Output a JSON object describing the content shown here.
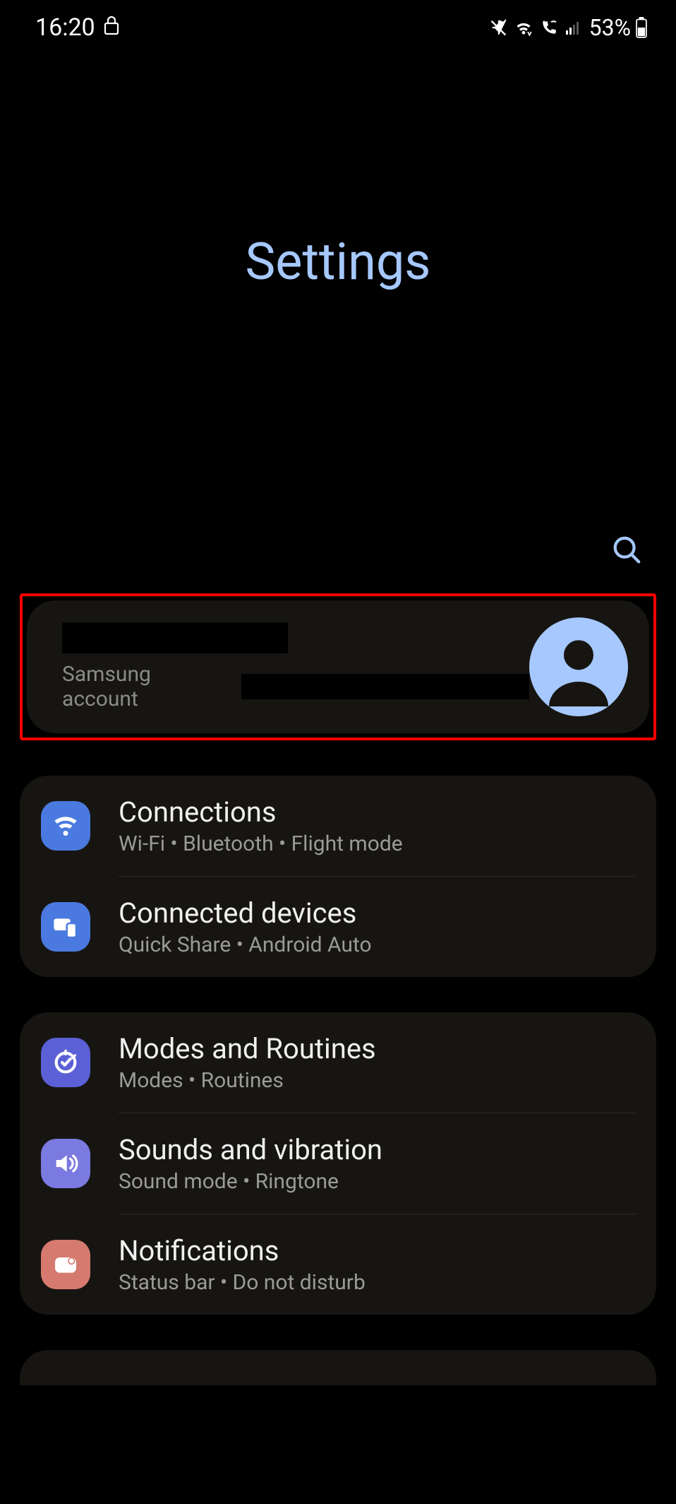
{
  "status": {
    "time": "16:20",
    "battery_text": "53%"
  },
  "header": {
    "title": "Settings"
  },
  "account": {
    "subtitle": "Samsung account"
  },
  "groups": [
    {
      "items": [
        {
          "title": "Connections",
          "subtitle": "Wi-Fi  •  Bluetooth  •  Flight mode",
          "icon": "wifi",
          "iconClass": "ic-blue"
        },
        {
          "title": "Connected devices",
          "subtitle": "Quick Share  •  Android Auto",
          "icon": "devices",
          "iconClass": "ic-blue"
        }
      ]
    },
    {
      "items": [
        {
          "title": "Modes and Routines",
          "subtitle": "Modes  •  Routines",
          "icon": "routines",
          "iconClass": "ic-indigo"
        },
        {
          "title": "Sounds and vibration",
          "subtitle": "Sound mode  •  Ringtone",
          "icon": "sound",
          "iconClass": "ic-purple"
        },
        {
          "title": "Notifications",
          "subtitle": "Status bar  •  Do not disturb",
          "icon": "notifications",
          "iconClass": "ic-coral"
        }
      ]
    }
  ]
}
